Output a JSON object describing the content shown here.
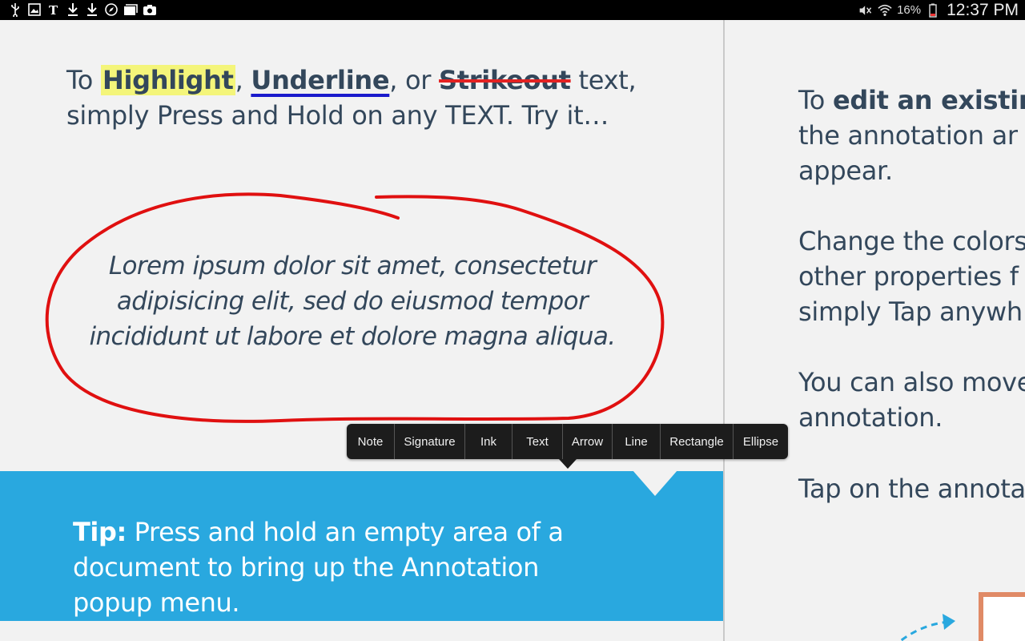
{
  "status_bar": {
    "left_icons": [
      "usb-icon",
      "image-icon",
      "nyt-icon",
      "download-icon",
      "download-icon",
      "compass-icon",
      "photo-stack-icon",
      "camera-icon"
    ],
    "right_icons": [
      "mute-icon",
      "wifi-icon",
      "battery-icon"
    ],
    "battery": "16%",
    "time": "12:37 PM"
  },
  "intro": {
    "prefix": "To ",
    "highlight": "Highlight",
    "sep1": ", ",
    "underline": "Underline",
    "sep2": ", or ",
    "strikeout": "Strikeout",
    "suffix": " text,",
    "line2": "simply Press and Hold on any TEXT. Try it…"
  },
  "lorem": {
    "line1": "Lorem ipsum dolor sit amet, consectetur",
    "line2": "adipisicing elit, sed do eiusmod tempor",
    "line3": "incididunt ut labore et dolore magna aliqua."
  },
  "popup_menu": {
    "items": [
      "Note",
      "Signature",
      "Ink",
      "Text",
      "Arrow",
      "Line",
      "Rectangle",
      "Ellipse"
    ]
  },
  "tip": {
    "label": "Tip:",
    "line1": " Press and hold an empty area of a",
    "line2": "document to bring up the Annotation",
    "line3": "popup menu."
  },
  "right_page": {
    "p1_prefix": "To ",
    "p1_bold": "edit an existin",
    "p1_line2": "the annotation ar",
    "p1_line3": "appear.",
    "p2_line1": "Change the colors",
    "p2_line2": "other properties f",
    "p2_line3": "simply Tap anywh",
    "p3_line1": "You can also move",
    "p3_line2": "annotation.",
    "p4_line1": "Tap on the annota"
  },
  "colors": {
    "ink_red": "#e01010",
    "tip_blue": "#29a8df",
    "body_text": "#33475b",
    "highlight_yellow": "#f4f57a"
  }
}
